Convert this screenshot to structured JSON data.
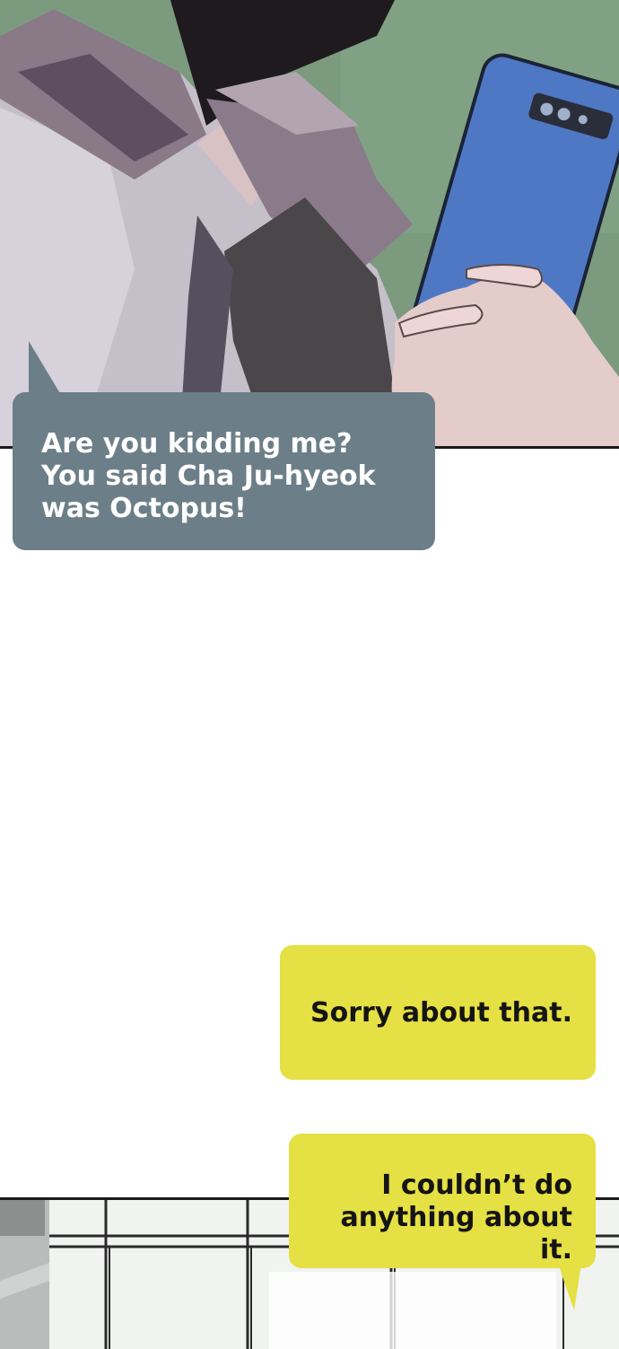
{
  "bubbles": {
    "first": {
      "lines": [
        "Are you kidding me?",
        "You said Cha Ju-hyeok",
        "was Octopus!"
      ]
    },
    "second": {
      "lines": [
        "Sorry about that."
      ]
    },
    "third": {
      "lines": [
        "I couldn’t do",
        "anything about it."
      ]
    }
  },
  "colors": {
    "blue_bubble": "#6c7f88",
    "yellow_bubble": "#e5e043",
    "phone": "#4f78c4",
    "background_green": "#7b9a7e"
  }
}
